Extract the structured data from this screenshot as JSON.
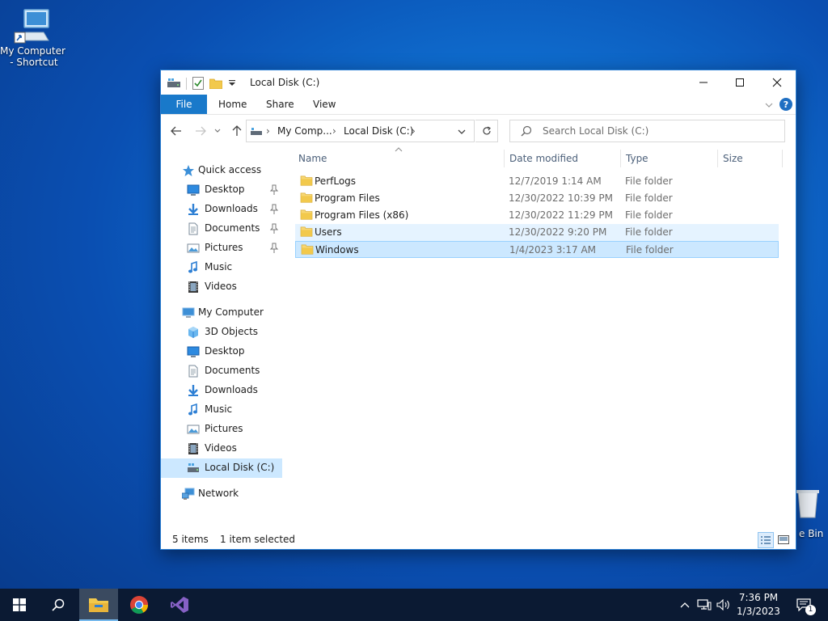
{
  "desktop": {
    "icons": [
      {
        "label": "My Computer\n - Shortcut",
        "icon": "computer-shortcut-icon"
      },
      {
        "label": "e Bin",
        "icon": "recycle-bin-icon"
      }
    ]
  },
  "window": {
    "title": "Local Disk (C:)",
    "tabs": [
      {
        "label": "File"
      },
      {
        "label": "Home"
      },
      {
        "label": "Share"
      },
      {
        "label": "View"
      }
    ],
    "breadcrumb": [
      {
        "label": "My Comp..."
      },
      {
        "label": "Local Disk (C:)"
      }
    ],
    "search_placeholder": "Search Local Disk (C:)",
    "columns": [
      {
        "label": "Name"
      },
      {
        "label": "Date modified"
      },
      {
        "label": "Type"
      },
      {
        "label": "Size"
      }
    ],
    "files": [
      {
        "name": "PerfLogs",
        "date": "12/7/2019 1:14 AM",
        "type": "File folder"
      },
      {
        "name": "Program Files",
        "date": "12/30/2022 10:39 PM",
        "type": "File folder"
      },
      {
        "name": "Program Files (x86)",
        "date": "12/30/2022 11:29 PM",
        "type": "File folder"
      },
      {
        "name": "Users",
        "date": "12/30/2022 9:20 PM",
        "type": "File folder"
      },
      {
        "name": "Windows",
        "date": "1/4/2023 3:17 AM",
        "type": "File folder"
      }
    ],
    "nav": {
      "quick_access": {
        "label": "Quick access"
      },
      "quick_items": [
        {
          "label": "Desktop",
          "icon": "desktop-icon"
        },
        {
          "label": "Downloads",
          "icon": "downloads-icon"
        },
        {
          "label": "Documents",
          "icon": "documents-icon"
        },
        {
          "label": "Pictures",
          "icon": "pictures-icon"
        },
        {
          "label": "Music",
          "icon": "music-icon"
        },
        {
          "label": "Videos",
          "icon": "videos-icon"
        }
      ],
      "my_computer": {
        "label": "My Computer"
      },
      "computer_items": [
        {
          "label": "3D Objects",
          "icon": "3d-objects-icon"
        },
        {
          "label": "Desktop",
          "icon": "desktop-icon"
        },
        {
          "label": "Documents",
          "icon": "documents-icon"
        },
        {
          "label": "Downloads",
          "icon": "downloads-icon"
        },
        {
          "label": "Music",
          "icon": "music-icon"
        },
        {
          "label": "Pictures",
          "icon": "pictures-icon"
        },
        {
          "label": "Videos",
          "icon": "videos-icon"
        },
        {
          "label": "Local Disk (C:)",
          "icon": "drive-icon"
        }
      ],
      "network": {
        "label": "Network"
      }
    },
    "status": {
      "count": "5 items",
      "selection": "1 item selected"
    }
  },
  "taskbar": {
    "clock_time": "7:36 PM",
    "clock_date": "1/3/2023",
    "notification_count": "1"
  },
  "colors": {
    "accent": "#1979ca",
    "selection": "#cce8ff",
    "hover": "#e5f3ff",
    "folder": "#f2c94c"
  }
}
